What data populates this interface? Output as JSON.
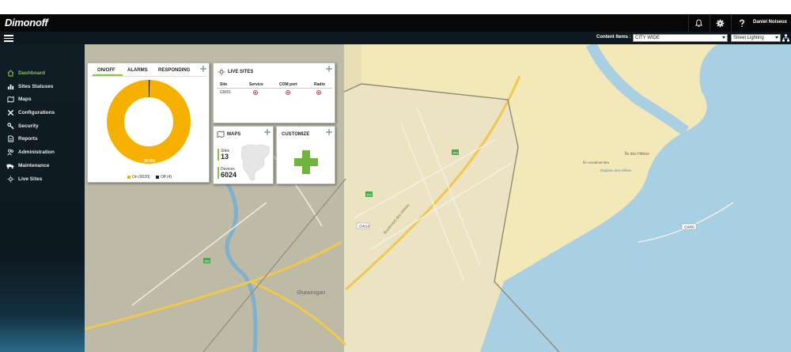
{
  "header": {
    "logo": "Dimonoff",
    "user_name": "Daniel Noiseux",
    "icons": [
      "bell-icon",
      "gear-icon",
      "help-icon"
    ]
  },
  "subbar": {
    "content_items_label": "Content Items :",
    "content_select_value": "CITY WIDE",
    "type_select_value": "Street Lighting"
  },
  "sidebar": {
    "items": [
      {
        "label": "Dashboard",
        "icon": "home-icon",
        "active": true
      },
      {
        "label": "Sites Statuses",
        "icon": "bar-chart-icon"
      },
      {
        "label": "Maps",
        "icon": "map-icon"
      },
      {
        "label": "Configurations",
        "icon": "wrench-icon"
      },
      {
        "label": "Security",
        "icon": "key-icon"
      },
      {
        "label": "Reports",
        "icon": "document-icon"
      },
      {
        "label": "Administration",
        "icon": "users-icon"
      },
      {
        "label": "Maintenance",
        "icon": "truck-icon"
      },
      {
        "label": "Live Sites",
        "icon": "light-icon"
      }
    ]
  },
  "onoff_widget": {
    "tabs": [
      "ON/OFF",
      "ALARMS",
      "RESPONDING"
    ],
    "percent_label": "99.9%",
    "legend_on": "On (6020)",
    "legend_off": "Off (4)",
    "on_count": 6020,
    "off_count": 4,
    "on_color": "#f5b000",
    "off_color": "#222222"
  },
  "live_sites_widget": {
    "title": "LIVE SITES",
    "columns": [
      "Site",
      "Service",
      "COM port",
      "Radio"
    ],
    "rows": [
      {
        "site": "GW01",
        "service": "alarm",
        "com_port": "alarm",
        "radio": "alarm"
      }
    ]
  },
  "maps_widget": {
    "title": "MAPS",
    "sites_label": "Sites",
    "sites_value": "13",
    "devices_label": "Devices",
    "devices_value": "6024"
  },
  "customize_widget": {
    "title": "CUSTOMIZE"
  },
  "map": {
    "labels": {
      "shawinigan": "Shawinigan",
      "boulevard": "Boulevard des Hetres",
      "ile_des_hetres": "Île des Hêtres",
      "ile_ansalmer": "Île Ansalmer-Bre",
      "rapides": "Rapides des Hêtres",
      "road_id_1": "GW14",
      "road_id_2": "GW06",
      "route_shield_1": "153",
      "route_shield_2": "153",
      "route_shield_3": "153"
    }
  }
}
